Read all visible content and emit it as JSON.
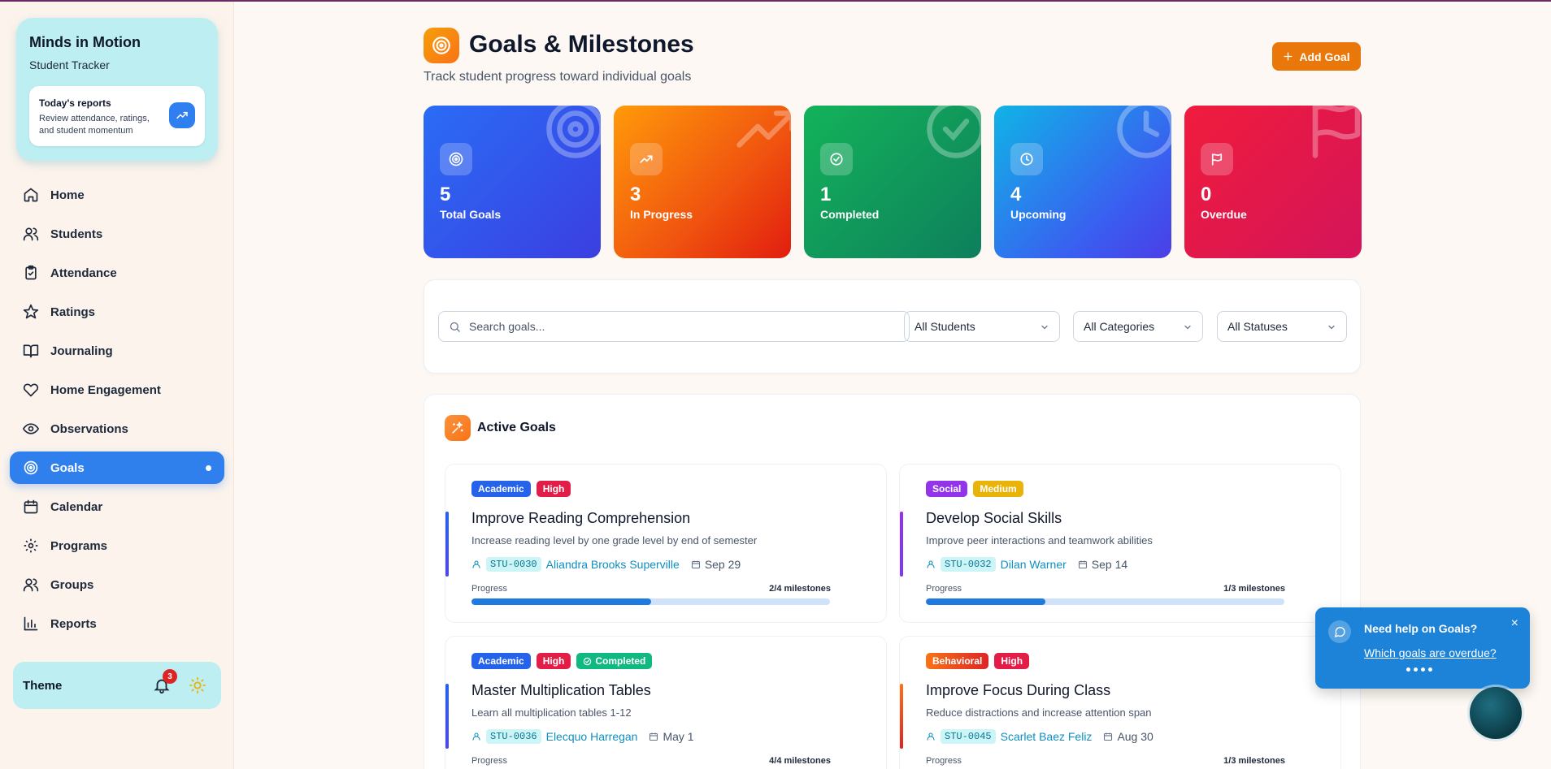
{
  "sidebar": {
    "brand": {
      "title": "Minds in Motion",
      "subtitle": "Student Tracker"
    },
    "report_card": {
      "title": "Today's reports",
      "description": "Review attendance, ratings, and student momentum"
    },
    "items": [
      {
        "label": "Home",
        "icon": "home-icon"
      },
      {
        "label": "Students",
        "icon": "users-icon"
      },
      {
        "label": "Attendance",
        "icon": "clipboard-check-icon"
      },
      {
        "label": "Ratings",
        "icon": "star-icon"
      },
      {
        "label": "Journaling",
        "icon": "book-icon"
      },
      {
        "label": "Home Engagement",
        "icon": "heart-icon"
      },
      {
        "label": "Observations",
        "icon": "eye-icon"
      },
      {
        "label": "Goals",
        "icon": "target-icon",
        "active": true
      },
      {
        "label": "Calendar",
        "icon": "calendar-icon"
      },
      {
        "label": "Programs",
        "icon": "gear-icon"
      },
      {
        "label": "Groups",
        "icon": "users-icon"
      },
      {
        "label": "Reports",
        "icon": "bar-chart-icon"
      }
    ],
    "theme": {
      "label": "Theme",
      "notification_count": "3"
    }
  },
  "header": {
    "title": "Goals & Milestones",
    "subtitle": "Track student progress toward individual goals",
    "add_label": "Add Goal"
  },
  "stats": [
    {
      "value": "5",
      "label": "Total Goals",
      "color": "#2563eb"
    },
    {
      "value": "3",
      "label": "In Progress",
      "color": "#f97316"
    },
    {
      "value": "1",
      "label": "Completed",
      "color": "#16a34a"
    },
    {
      "value": "4",
      "label": "Upcoming",
      "color": "#0ea5e9"
    },
    {
      "value": "0",
      "label": "Overdue",
      "color": "#e11d48"
    }
  ],
  "filters": {
    "search_placeholder": "Search goals...",
    "students": "All Students",
    "categories": "All Categories",
    "statuses": "All Statuses"
  },
  "goals_section": {
    "title": "Active Goals",
    "progress_label": "Progress",
    "goals": [
      {
        "category": "Academic",
        "priority": "High",
        "status": "",
        "title": "Improve Reading Comprehension",
        "description": "Increase reading level by one grade level by end of semester",
        "student_id": "STU-0030",
        "student_name": "Aliandra Brooks Superville",
        "date": "Sep 29",
        "milestones": "2/4 milestones",
        "progress": 0.5
      },
      {
        "category": "Social",
        "priority": "Medium",
        "status": "",
        "title": "Develop Social Skills",
        "description": "Improve peer interactions and teamwork abilities",
        "student_id": "STU-0032",
        "student_name": "Dilan Warner",
        "date": "Sep 14",
        "milestones": "1/3 milestones",
        "progress": 0.333
      },
      {
        "category": "Academic",
        "priority": "High",
        "status": "Completed",
        "title": "Master Multiplication Tables",
        "description": "Learn all multiplication tables 1-12",
        "student_id": "STU-0036",
        "student_name": "Elecquo Harregan",
        "date": "May 1",
        "milestones": "4/4 milestones",
        "progress": 1
      },
      {
        "category": "Behavioral",
        "priority": "High",
        "status": "",
        "title": "Improve Focus During Class",
        "description": "Reduce distractions and increase attention span",
        "student_id": "STU-0045",
        "student_name": "Scarlet Baez Feliz",
        "date": "Aug 30",
        "milestones": "1/3 milestones",
        "progress": 0.333
      }
    ]
  },
  "help": {
    "title": "Need help on Goals?",
    "link": "Which goals are overdue?"
  }
}
